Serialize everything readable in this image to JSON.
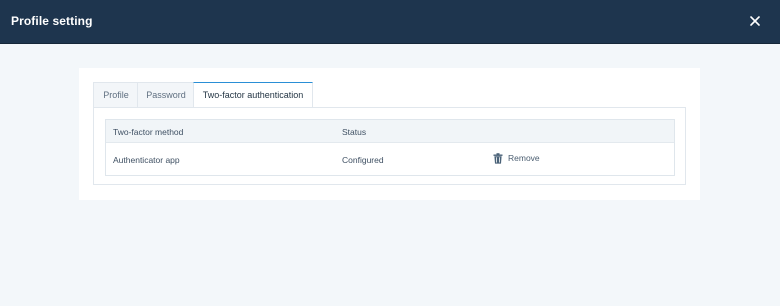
{
  "window": {
    "title": "Profile setting",
    "close_icon": "close-icon"
  },
  "tabs": [
    {
      "label": "Profile",
      "active": false
    },
    {
      "label": "Password",
      "active": false
    },
    {
      "label": "Two-factor authentication",
      "active": true
    }
  ],
  "table": {
    "columns": [
      "Two-factor method",
      "Status"
    ],
    "rows": [
      {
        "method": "Authenticator app",
        "status": "Configured",
        "action": "Remove",
        "action_icon": "trash-icon"
      }
    ]
  },
  "colors": {
    "titlebar": "#1e354e",
    "active_tab_accent": "#2a8fd6",
    "page_background": "#f3f7fa"
  }
}
